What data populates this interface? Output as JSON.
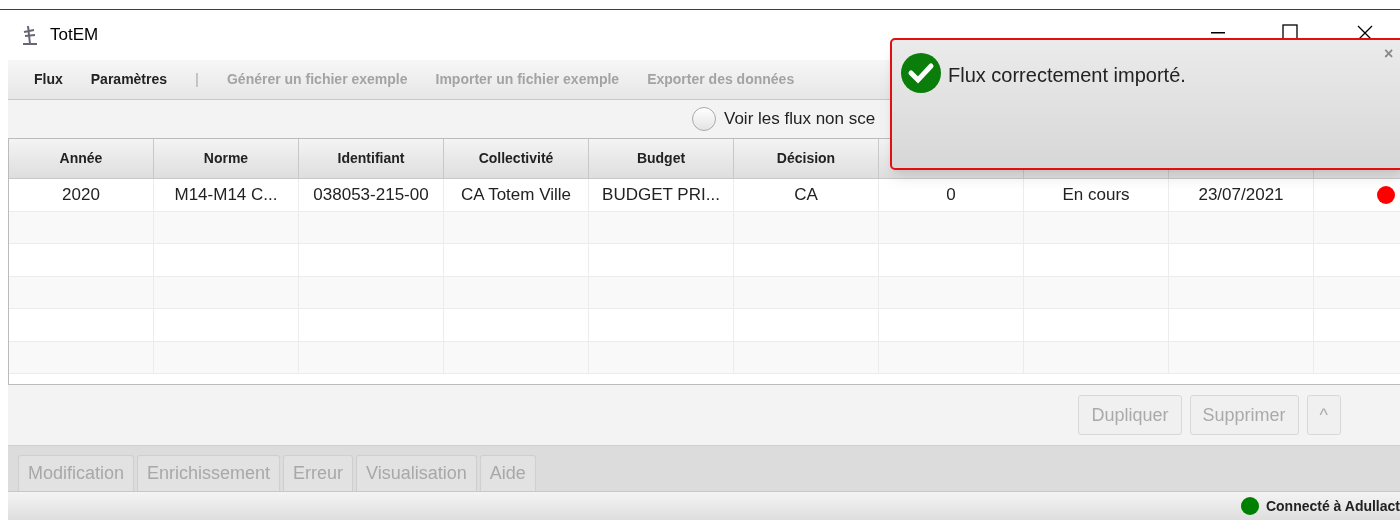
{
  "window": {
    "title": "TotEM"
  },
  "menu": [
    {
      "label": "Flux",
      "disabled": false
    },
    {
      "label": "Paramètres",
      "disabled": false
    },
    {
      "label": "|",
      "disabled": false
    },
    {
      "label": "Générer un fichier exemple",
      "disabled": true
    },
    {
      "label": "Importer un fichier exemple",
      "disabled": true
    },
    {
      "label": "Exporter des données",
      "disabled": true
    }
  ],
  "filter": {
    "label": "Voir les flux non sce",
    "checked": false
  },
  "table": {
    "columns": [
      "Année",
      "Norme",
      "Identifiant",
      "Collectivité",
      "Budget",
      "Décision"
    ],
    "rows": [
      {
        "cells": [
          "2020",
          "M14-M14  C...",
          "038053-215-00",
          "CA Totem Ville",
          "BUDGET PRI...",
          "CA",
          "0",
          "En cours",
          "23/07/2021"
        ],
        "color": "#ff0000"
      }
    ]
  },
  "buttons": [
    {
      "label": "Dupliquer",
      "disabled": true
    },
    {
      "label": "Supprimer",
      "disabled": true
    },
    {
      "label": "^",
      "disabled": true
    }
  ],
  "tabs": [
    {
      "label": "Modification",
      "disabled": true
    },
    {
      "label": "Enrichissement",
      "disabled": true
    },
    {
      "label": "Erreur",
      "disabled": true
    },
    {
      "label": "Visualisation",
      "disabled": true
    },
    {
      "label": "Aide",
      "disabled": true
    }
  ],
  "status_bar": {
    "text": "Connecté à Adullact",
    "color": "#008000"
  },
  "notification": {
    "message": "Flux correctement importé.",
    "close": "×"
  }
}
